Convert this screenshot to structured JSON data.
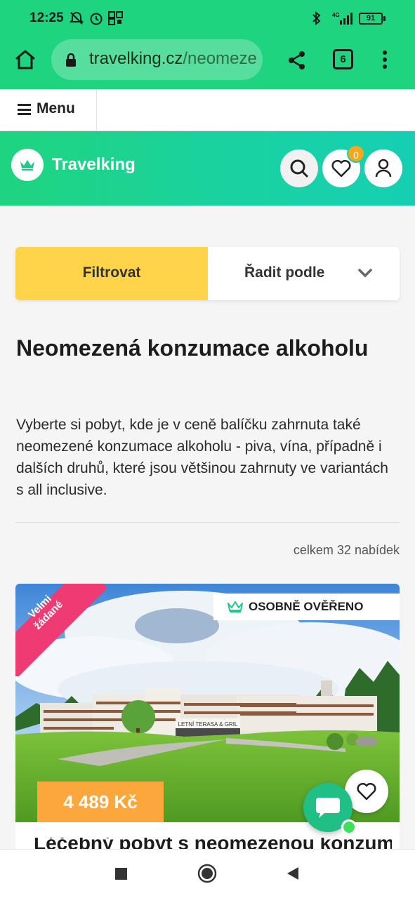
{
  "status_bar": {
    "time": "12:25",
    "battery": "91",
    "network": "4G"
  },
  "browser": {
    "url_domain": "travelking.cz",
    "url_path": "/neomeze",
    "tab_count": "6"
  },
  "menu": {
    "label": "Menu"
  },
  "site_header": {
    "brand": "Travelking",
    "favorites_count": "0",
    "colors": {
      "primary": "#1fd47f",
      "accent": "#ffd44a",
      "badge": "#f5a623"
    }
  },
  "filter_bar": {
    "filter_label": "Filtrovat",
    "sort_label": "Řadit podle"
  },
  "page": {
    "title": "Neomezená konzumace alkoholu",
    "description": "Vyberte si pobyt, kde je v ceně balíčku zahrnuta také neomezené konzumace alkoholu - piva, vína, případně i dalších druhů, které jsou většinou zahrnuty ve variantách s all inclusive.",
    "offer_count": "celkem 32 nabídek"
  },
  "card": {
    "ribbon": "Velmi žádané",
    "verified": "OSOBNĚ OVĚŘENO",
    "hotel_sign": "LETNÍ TERASA & GRIL",
    "price": "4 489 Kč",
    "title_partial": "Léčebný pobyt s neomezenou konzumací"
  }
}
